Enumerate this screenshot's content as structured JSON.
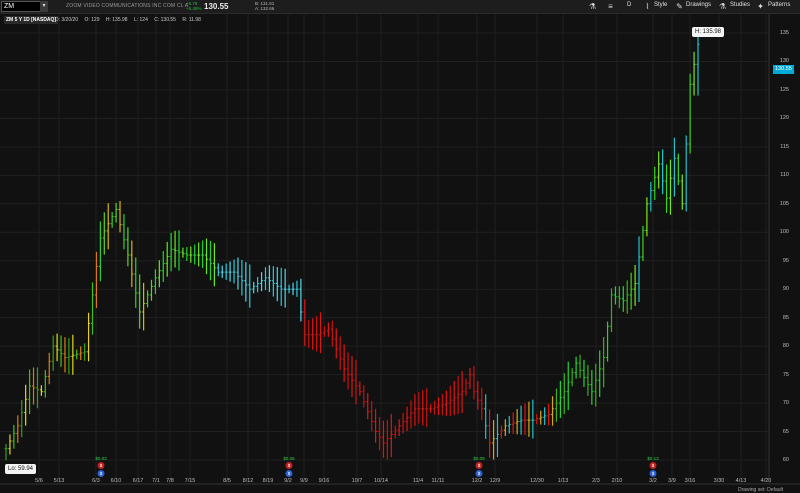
{
  "toolbar": {
    "symbol": "ZM",
    "company_name": "ZOOM VIDEO COMMUNICATIONS INC COM CL A",
    "net_change": "+6.76",
    "pct_change": "+5.46%",
    "last_price": "130.55",
    "bid": "B: 131.61",
    "ask": "A: 132.66",
    "period_label": "D",
    "style_label": "Style",
    "drawings_label": "Drawings",
    "studies_label": "Studies",
    "patterns_label": "Patterns"
  },
  "chart": {
    "title": "ZM 5 Y 1D [NASDAQ]",
    "ohlc": {
      "date": "D: 3/20/20",
      "open": "O: 129",
      "high": "H: 135.98",
      "low": "L: 124",
      "close": "C: 130.55",
      "range": "R: 11.98"
    },
    "high_label": "H: 135.98",
    "low_label": "Lo: 59.94",
    "price_tag": "130.55",
    "drawing_set": "Drawing set: Default"
  },
  "chart_data": {
    "type": "bar",
    "ylim": [
      58,
      138
    ],
    "y_ticks": [
      "135",
      "130",
      "125",
      "120",
      "115",
      "110",
      "105",
      "100",
      "95",
      "90",
      "85",
      "80",
      "75",
      "70",
      "65",
      "60"
    ],
    "x_ticks": [
      "5/6",
      "5/13",
      "6/3",
      "6/10",
      "6/17",
      "7/1",
      "7/8",
      "7/15",
      "8/5",
      "8/12",
      "8/19",
      "9/2",
      "9/9",
      "9/16",
      "10/7",
      "10/14",
      "11/4",
      "11/11",
      "12/2",
      "12/9",
      "12/30",
      "1/13",
      "2/3",
      "2/10",
      "3/2",
      "3/9",
      "3/16",
      "3/30",
      "4/13",
      "4/20"
    ],
    "anchors": [
      [
        0,
        62
      ],
      [
        3,
        66
      ],
      [
        6,
        73
      ],
      [
        9,
        72
      ],
      [
        12,
        80
      ],
      [
        15,
        78
      ],
      [
        20,
        79
      ],
      [
        24,
        99
      ],
      [
        28,
        104
      ],
      [
        31,
        96
      ],
      [
        34,
        86
      ],
      [
        38,
        92
      ],
      [
        42,
        97
      ],
      [
        46,
        96
      ],
      [
        50,
        96
      ],
      [
        54,
        93
      ],
      [
        58,
        93
      ],
      [
        62,
        90
      ],
      [
        66,
        92
      ],
      [
        70,
        90
      ],
      [
        74,
        90
      ],
      [
        76,
        82
      ],
      [
        79,
        82
      ],
      [
        82,
        83
      ],
      [
        86,
        76
      ],
      [
        90,
        72
      ],
      [
        94,
        65
      ],
      [
        96,
        63
      ],
      [
        100,
        66
      ],
      [
        104,
        69
      ],
      [
        108,
        69
      ],
      [
        112,
        70
      ],
      [
        116,
        72
      ],
      [
        118,
        75
      ],
      [
        119,
        72
      ],
      [
        121,
        69
      ],
      [
        123,
        63
      ],
      [
        127,
        66
      ],
      [
        131,
        67
      ],
      [
        134,
        67
      ],
      [
        138,
        68
      ],
      [
        142,
        72
      ],
      [
        145,
        77
      ],
      [
        149,
        72
      ],
      [
        152,
        78
      ],
      [
        154,
        89
      ],
      [
        157,
        88
      ],
      [
        160,
        91
      ],
      [
        163,
        105
      ],
      [
        166,
        112
      ],
      [
        168,
        106
      ],
      [
        170,
        113
      ],
      [
        172,
        105
      ],
      [
        174,
        126
      ],
      [
        176,
        133
      ]
    ],
    "color_stops": [
      {
        "from": 0,
        "to": 23,
        "colors": [
          "#2fa11d",
          "#e07a10",
          "#3fc21c",
          "#e6d21c"
        ]
      },
      {
        "from": 24,
        "to": 37,
        "colors": [
          "#2bd13a",
          "#61d11e",
          "#d6b514"
        ]
      },
      {
        "from": 38,
        "to": 53,
        "colors": [
          "#1fd33d",
          "#6de41c"
        ]
      },
      {
        "from": 54,
        "to": 75,
        "colors": [
          "#2ac9dc",
          "#51d6e6"
        ]
      },
      {
        "from": 76,
        "to": 121,
        "colors": [
          "#e01414",
          "#c91010"
        ]
      },
      {
        "from": 122,
        "to": 139,
        "colors": [
          "#e01414",
          "#d6a819",
          "#1fc3cc"
        ]
      },
      {
        "from": 140,
        "to": 158,
        "colors": [
          "#3fae1c",
          "#1fd33d"
        ]
      },
      {
        "from": 159,
        "to": 176,
        "colors": [
          "#38d61f",
          "#7ee51c",
          "#1fc3cc"
        ]
      }
    ],
    "dividends": [
      {
        "x_label": "6/3",
        "amount": "$0.03"
      },
      {
        "x_label": "9/2",
        "amount": "$0.06"
      },
      {
        "x_label": "12/2",
        "amount": "$0.09"
      },
      {
        "x_label": "3/2",
        "amount": "$0.13"
      }
    ]
  }
}
